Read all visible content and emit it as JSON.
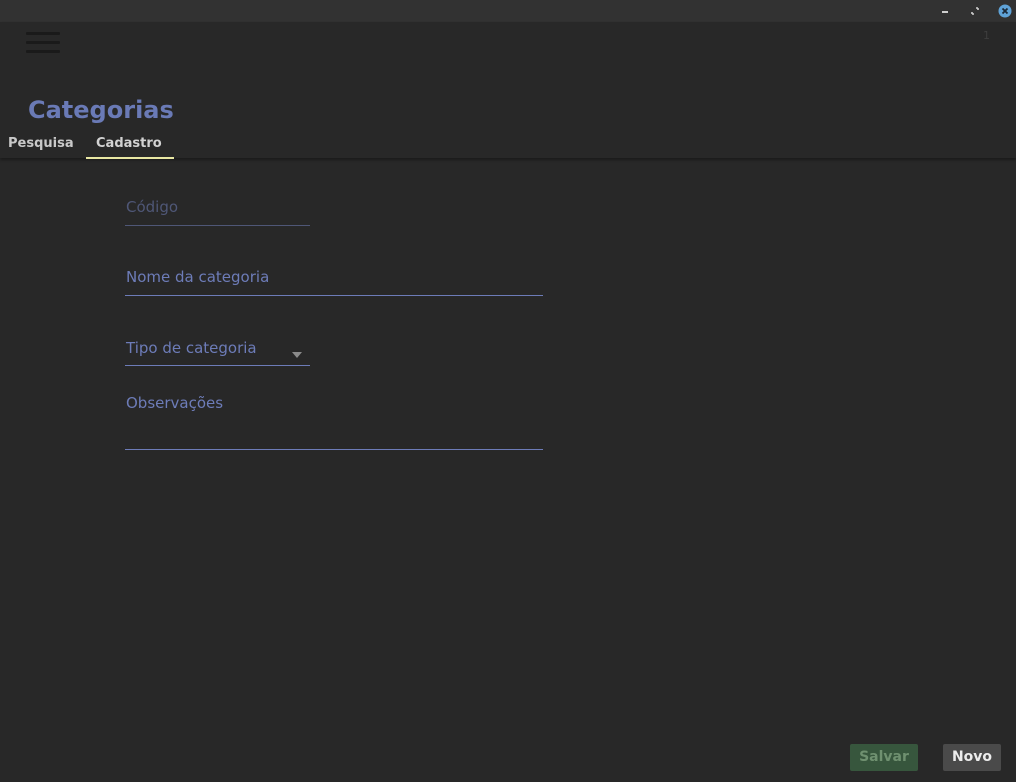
{
  "window": {
    "controls": [
      "minimize-icon",
      "maximize-icon",
      "close-icon"
    ],
    "close_color": "#5fa3d8"
  },
  "header": {
    "menu_icon": "hamburger-menu-icon",
    "count": "1",
    "title": "Categorias"
  },
  "tabs": [
    {
      "label": "Pesquisa",
      "active": false
    },
    {
      "label": "Cadastro",
      "active": true
    }
  ],
  "form": {
    "codigo": {
      "label": "Código",
      "value": "",
      "disabled": true
    },
    "nome": {
      "label": "Nome da categoria",
      "value": ""
    },
    "tipo": {
      "label": "Tipo de categoria",
      "value": "",
      "icon": "dropdown-arrow-icon"
    },
    "observacoes": {
      "label": "Observações",
      "value": ""
    }
  },
  "actions": {
    "salvar": "Salvar",
    "novo": "Novo"
  },
  "colors": {
    "background": "#282828",
    "accent": "#6a7ab6",
    "tab_indicator": "#e8e7a3",
    "save_button": "#37563d"
  }
}
